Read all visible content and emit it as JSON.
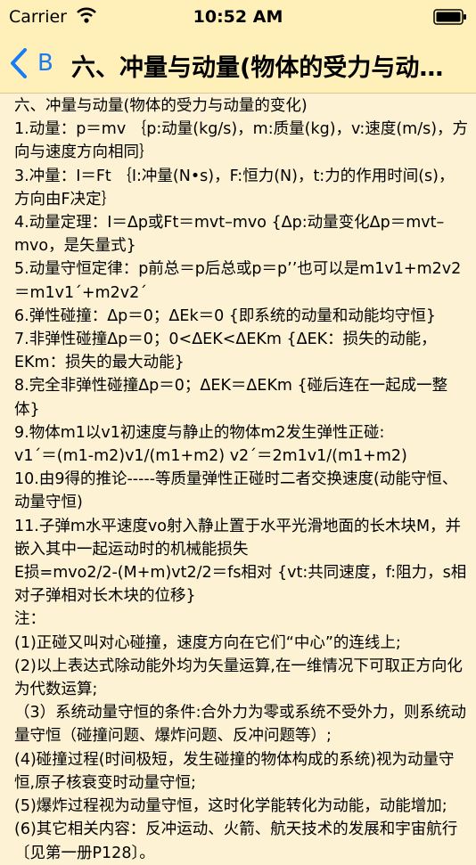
{
  "status_bar": {
    "carrier": "Carrier",
    "time": "10:52 AM"
  },
  "nav": {
    "back_label": "B",
    "title": "六、冲量与动量(物体的受力与动量的变化)",
    "accent_color": "#1a7cf5"
  },
  "content": {
    "paragraphs": [
      "六、冲量与动量(物体的受力与动量的变化)",
      "1.动量：p＝mv ｛p:动量(kg/s)，m:质量(kg)，v:速度(m/s)，方向与速度方向相同｝",
      "3.冲量：I＝Ft ｛I:冲量(N•s)，F:恒力(N)，t:力的作用时间(s)，方向由F决定｝",
      "4.动量定理：I＝Δp或Ft＝mvt–mvo {Δp:动量变化Δp＝mvt–mvo，是矢量式}",
      "5.动量守恒定律：p前总＝p后总或p＝p’’也可以是m1v1+m2v2＝m1v1´+m2v2´",
      "6.弹性碰撞：Δp＝0；ΔEk＝0 {即系统的动量和动能均守恒}",
      "7.非弹性碰撞Δp＝0；0<ΔEK<ΔEKm {ΔEK：损失的动能，EKm：损失的最大动能}",
      "8.完全非弹性碰撞Δp＝0；ΔEK＝ΔEKm {碰后连在一起成一整体}",
      "9.物体m1以v1初速度与静止的物体m2发生弹性正碰:",
      "v1´＝(m1-m2)v1/(m1+m2) v2´＝2m1v1/(m1+m2)",
      "10.由9得的推论-----等质量弹性正碰时二者交换速度(动能守恒、动量守恒)",
      "11.子弹m水平速度vo射入静止置于水平光滑地面的长木块M，并嵌入其中一起运动时的机械能损失",
      "E损=mvo2/2-(M+m)vt2/2＝fs相对 {vt:共同速度，f:阻力，s相对子弹相对长木块的位移}",
      "注：",
      "(1)正碰又叫对心碰撞，速度方向在它们“中心”的连线上;",
      "(2)以上表达式除动能外均为矢量运算,在一维情况下可取正方向化为代数运算;",
      "（3）系统动量守恒的条件:合外力为零或系统不受外力，则系统动量守恒（碰撞问题、爆炸问题、反冲问题等）;",
      "(4)碰撞过程(时间极短，发生碰撞的物体构成的系统)视为动量守恒,原子核衰变时动量守恒;",
      "(5)爆炸过程视为动量守恒，这时化学能转化为动能，动能增加;(6)其它相关内容：反冲运动、火箭、航天技术的发展和宇宙航行〔见第一册P128〕。"
    ]
  }
}
